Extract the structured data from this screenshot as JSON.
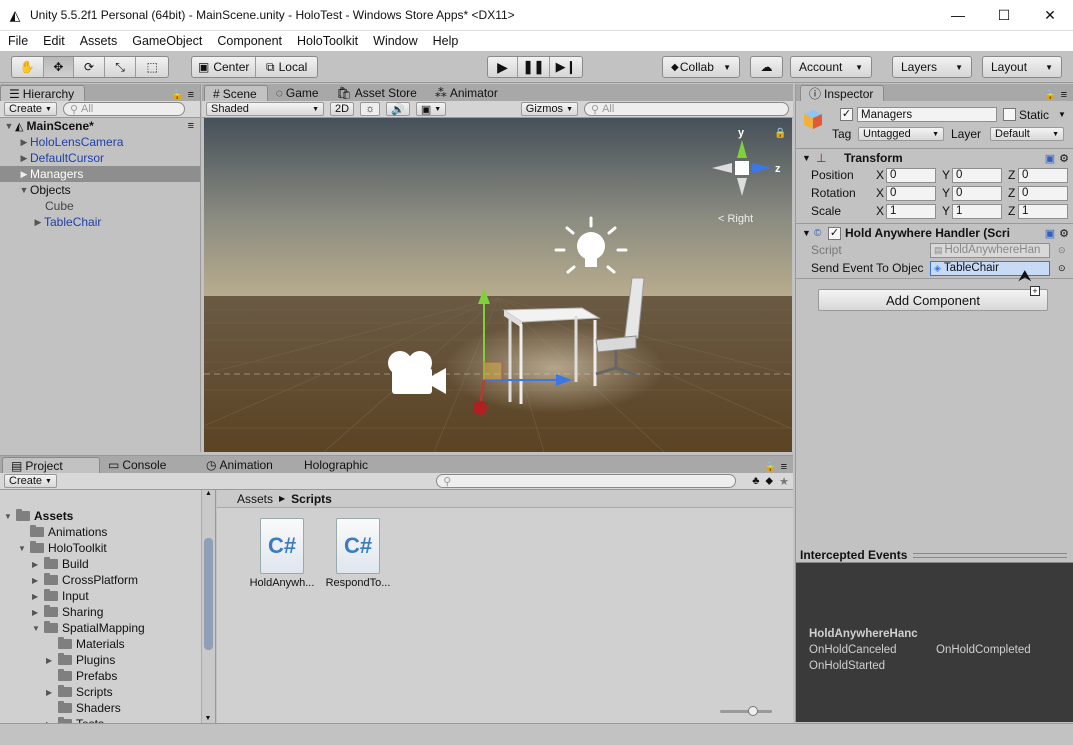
{
  "window": {
    "title": "Unity 5.5.2f1 Personal (64bit) - MainScene.unity - HoloTest - Windows Store Apps* <DX11>"
  },
  "menu": [
    "File",
    "Edit",
    "Assets",
    "GameObject",
    "Component",
    "HoloToolkit",
    "Window",
    "Help"
  ],
  "toolbar": {
    "center": "Center",
    "local": "Local",
    "collab": "Collab",
    "account": "Account",
    "layers": "Layers",
    "layout": "Layout"
  },
  "hierarchy": {
    "tab": "Hierarchy",
    "create": "Create",
    "search_placeholder": "All",
    "items": [
      {
        "label": "MainScene*",
        "indent": 0
      },
      {
        "label": "HoloLensCamera",
        "indent": 1
      },
      {
        "label": "DefaultCursor",
        "indent": 1
      },
      {
        "label": "Managers",
        "indent": 1
      },
      {
        "label": "Objects",
        "indent": 1
      },
      {
        "label": "Cube",
        "indent": 2
      },
      {
        "label": "TableChair",
        "indent": 2
      }
    ]
  },
  "scene": {
    "tabs": [
      "Scene",
      "Game",
      "Asset Store",
      "Animator"
    ],
    "shading": "Shaded",
    "mode2d": "2D",
    "gizmos": "Gizmos",
    "search_placeholder": "All",
    "gizmo": {
      "y": "y",
      "z": "z",
      "view": "Right"
    }
  },
  "inspector": {
    "tab": "Inspector",
    "name": "Managers",
    "static": "Static",
    "tag_label": "Tag",
    "tag": "Untagged",
    "layer_label": "Layer",
    "layer": "Default",
    "transform": {
      "title": "Transform",
      "position": {
        "label": "Position",
        "x": "0",
        "y": "0",
        "z": "0"
      },
      "rotation": {
        "label": "Rotation",
        "x": "0",
        "y": "0",
        "z": "0"
      },
      "scale": {
        "label": "Scale",
        "x": "1",
        "y": "1",
        "z": "1"
      }
    },
    "component": {
      "title": "Hold Anywhere Handler (Scri",
      "script_label": "Script",
      "script_value": "HoldAnywhereHan",
      "send_label": "Send Event To Objec",
      "send_value": "TableChair"
    },
    "add_component": "Add Component"
  },
  "intercepted": {
    "title": "Intercepted Events",
    "handler": "HoldAnywhereHanc",
    "events": [
      "OnHoldCanceled",
      "OnHoldCompleted",
      "OnHoldStarted"
    ]
  },
  "project": {
    "tabs": [
      "Project",
      "Console",
      "Animation",
      "Holographic"
    ],
    "create": "Create",
    "breadcrumb": [
      "Assets",
      "Scripts"
    ],
    "tree": [
      {
        "label": "Assets",
        "indent": 0
      },
      {
        "label": "Animations",
        "indent": 1
      },
      {
        "label": "HoloToolkit",
        "indent": 1
      },
      {
        "label": "Build",
        "indent": 2
      },
      {
        "label": "CrossPlatform",
        "indent": 2
      },
      {
        "label": "Input",
        "indent": 2
      },
      {
        "label": "Sharing",
        "indent": 2
      },
      {
        "label": "SpatialMapping",
        "indent": 2
      },
      {
        "label": "Materials",
        "indent": 3
      },
      {
        "label": "Plugins",
        "indent": 3
      },
      {
        "label": "Prefabs",
        "indent": 3
      },
      {
        "label": "Scripts",
        "indent": 3
      },
      {
        "label": "Shaders",
        "indent": 3
      },
      {
        "label": "Tests",
        "indent": 3
      }
    ],
    "files": [
      "HoldAnywh...",
      "RespondTo..."
    ]
  }
}
